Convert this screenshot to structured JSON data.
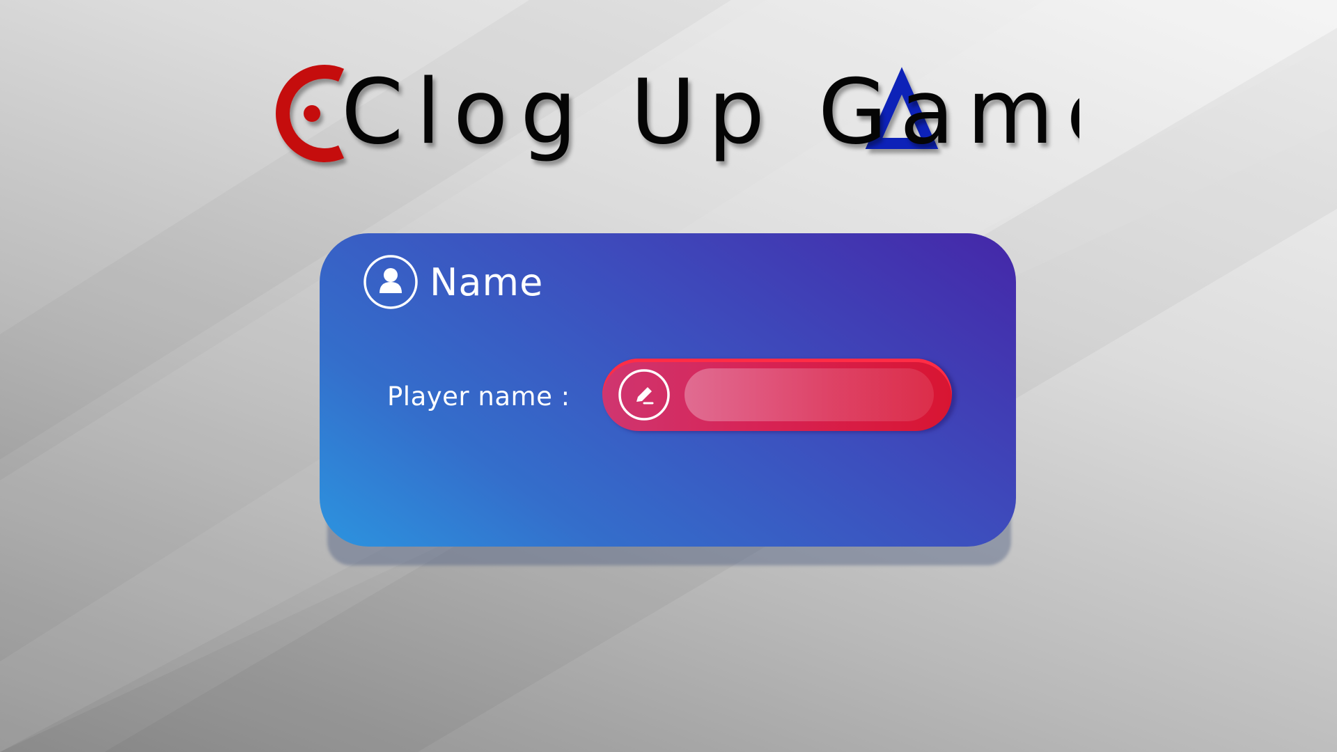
{
  "logo": {
    "title": "Clog Up Game",
    "colors": {
      "ring": "#c50d0d",
      "triangle": "#0b22b8",
      "letters": "#050505"
    }
  },
  "card": {
    "title": "Name",
    "title_icon": "user-circle-icon",
    "field_label": "Player name :",
    "input": {
      "value": "",
      "placeholder": "",
      "icon": "pencil-edit-icon"
    },
    "colors": {
      "gradient_start": "#2c94df",
      "gradient_end": "#4527a8",
      "input_accent": "#d81532"
    }
  }
}
